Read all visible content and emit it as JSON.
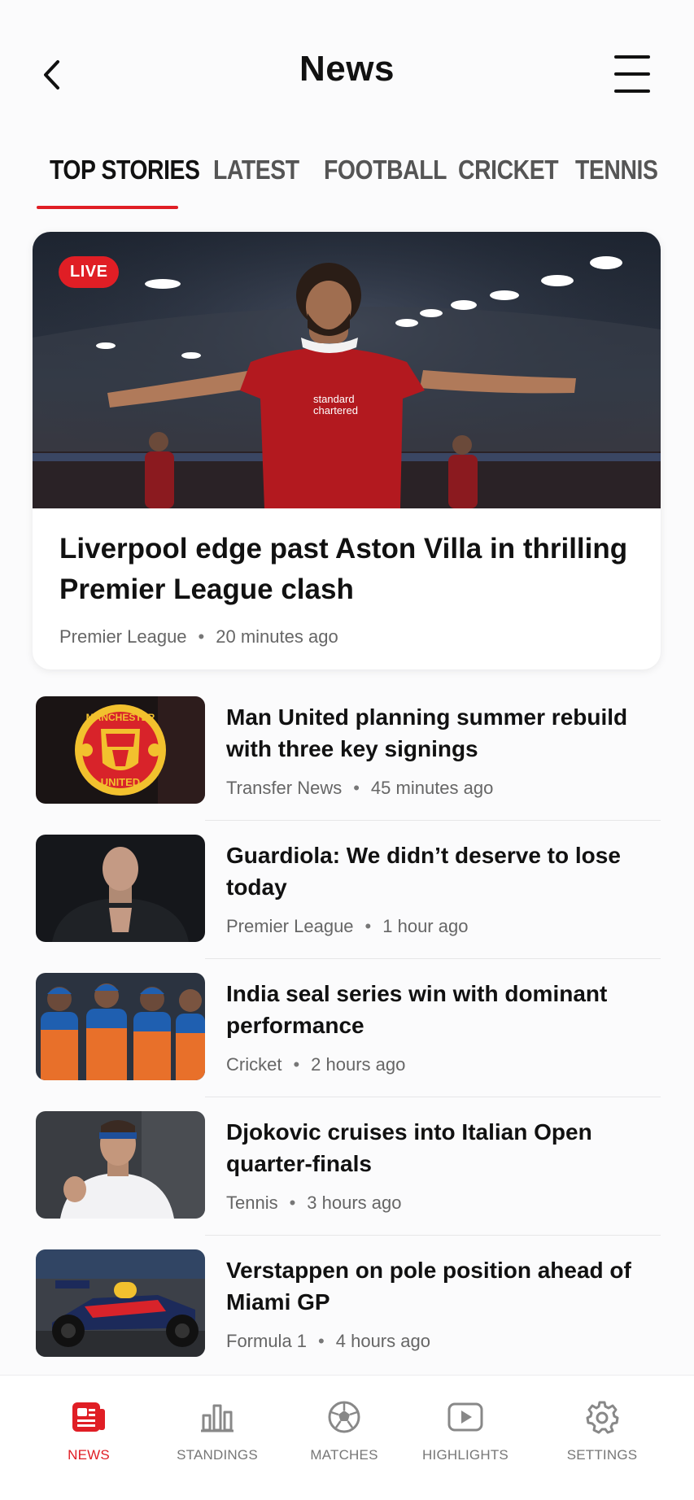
{
  "header": {
    "title": "News",
    "back_icon": "chevron-left-icon",
    "menu_icon": "hamburger-menu-icon"
  },
  "tabs": [
    {
      "label": "TOP STORIES",
      "active": true
    },
    {
      "label": "LATEST",
      "active": false
    },
    {
      "label": "FOOTBALL",
      "active": false
    },
    {
      "label": "CRICKET",
      "active": false
    },
    {
      "label": "TENNIS",
      "active": false
    }
  ],
  "featured": {
    "badge": "LIVE",
    "title": "Liverpool edge past Aston Villa in thrilling Premier League clash",
    "category": "Premier League",
    "separator": "•",
    "time": "20 minutes ago"
  },
  "news": [
    {
      "title": "Man United planning summer rebuild with three key signings",
      "category": "Transfer News",
      "separator": "•",
      "time": "45 minutes ago"
    },
    {
      "title": "Guardiola: We didn’t deserve to lose today",
      "category": "Premier League",
      "separator": "•",
      "time": "1 hour ago"
    },
    {
      "title": "India seal series win with dominant performance",
      "category": "Cricket",
      "separator": "•",
      "time": "2 hours ago"
    },
    {
      "title": "Djokovic cruises into Italian Open quarter-finals",
      "category": "Tennis",
      "separator": "•",
      "time": "3 hours ago"
    },
    {
      "title": "Verstappen on pole position ahead of Miami GP",
      "category": "Formula 1",
      "separator": "•",
      "time": "4 hours ago"
    }
  ],
  "thumb_text": {
    "crest_top": "MANCHESTER",
    "crest_bottom": "UNITED"
  },
  "bottom_nav": [
    {
      "label": "NEWS",
      "icon": "newspaper-icon",
      "active": true
    },
    {
      "label": "STANDINGS",
      "icon": "bar-chart-icon",
      "active": false
    },
    {
      "label": "MATCHES",
      "icon": "soccer-ball-icon",
      "active": false
    },
    {
      "label": "HIGHLIGHTS",
      "icon": "play-video-icon",
      "active": false
    },
    {
      "label": "SETTINGS",
      "icon": "gear-icon",
      "active": false
    }
  ],
  "colors": {
    "accent": "#e01e25",
    "text": "#111111",
    "muted": "#666666"
  }
}
